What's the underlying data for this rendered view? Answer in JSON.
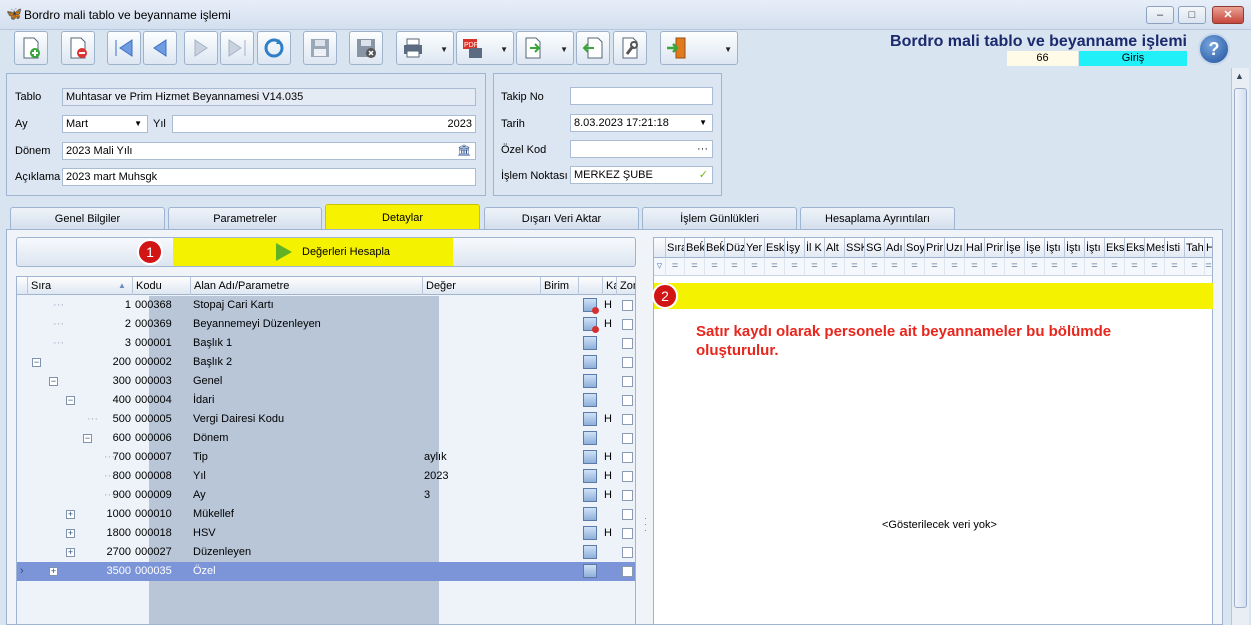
{
  "window": {
    "title": "Bordro mali tablo ve beyanname işlemi",
    "minimize": "–",
    "maximize": "□",
    "close": "✕"
  },
  "header": {
    "title": "Bordro mali tablo ve beyanname işlemi",
    "count": "66",
    "mode": "Giriş",
    "help": "?"
  },
  "toolbar": {
    "icons": [
      "new-doc-icon",
      "delete-doc-icon",
      "first-icon",
      "prev-icon",
      "next-icon",
      "last-icon",
      "refresh-icon",
      "save-icon",
      "cancel-save-icon",
      "print-icon",
      "pdf-icon",
      "export-icon",
      "import-icon",
      "tools-icon",
      "exit-icon"
    ]
  },
  "form_left": {
    "tablo_label": "Tablo",
    "tablo_value": "Muhtasar ve Prim Hizmet Beyannamesi V14.035",
    "ay_label": "Ay",
    "ay_value": "Mart",
    "yil_label": "Yıl",
    "yil_value": "2023",
    "donem_label": "Dönem",
    "donem_value": "2023 Mali Yılı",
    "aciklama_label": "Açıklama",
    "aciklama_value": "2023 mart Muhsgk"
  },
  "form_right": {
    "takip_label": "Takip No",
    "takip_value": "",
    "tarih_label": "Tarih",
    "tarih_value": "8.03.2023 17:21:18",
    "ozelkod_label": "Özel Kod",
    "ozelkod_value": "",
    "islem_label": "İşlem Noktası",
    "islem_value": "MERKEZ ŞUBE"
  },
  "tabs": [
    "Genel Bilgiler",
    "Parametreler",
    "Detaylar",
    "Dışarı Veri Aktar",
    "İşlem Günlükleri",
    "Hesaplama Ayrıntıları"
  ],
  "active_tab": "Detaylar",
  "calc_button": "Değerleri Hesapla",
  "badge1": "1",
  "badge2": "2",
  "left_grid": {
    "columns": [
      "Sıra",
      "Kodu",
      "Alan Adı/Parametre",
      "Değer",
      "Birim",
      "Ka",
      "Zor"
    ],
    "rows": [
      {
        "sira": "1",
        "kodu": "000368",
        "alan": "Stopaj Cari Kartı",
        "deger": "",
        "h": "H"
      },
      {
        "sira": "2",
        "kodu": "000369",
        "alan": "Beyannemeyi Düzenleyen",
        "deger": "",
        "h": "H"
      },
      {
        "sira": "3",
        "kodu": "000001",
        "alan": "Başlık 1",
        "deger": "",
        "h": ""
      },
      {
        "sira": "200",
        "kodu": "000002",
        "alan": "Başlık 2",
        "deger": "",
        "h": ""
      },
      {
        "sira": "300",
        "kodu": "000003",
        "alan": "Genel",
        "deger": "",
        "h": ""
      },
      {
        "sira": "400",
        "kodu": "000004",
        "alan": "İdari",
        "deger": "",
        "h": ""
      },
      {
        "sira": "500",
        "kodu": "000005",
        "alan": "Vergi Dairesi Kodu",
        "deger": "",
        "h": "H"
      },
      {
        "sira": "600",
        "kodu": "000006",
        "alan": "Dönem",
        "deger": "",
        "h": ""
      },
      {
        "sira": "700",
        "kodu": "000007",
        "alan": "Tip",
        "deger": "aylık",
        "h": "H"
      },
      {
        "sira": "800",
        "kodu": "000008",
        "alan": "Yıl",
        "deger": "2023",
        "h": "H"
      },
      {
        "sira": "900",
        "kodu": "000009",
        "alan": "Ay",
        "deger": "3",
        "h": "H"
      },
      {
        "sira": "1000",
        "kodu": "000010",
        "alan": "Mükellef",
        "deger": "",
        "h": ""
      },
      {
        "sira": "1800",
        "kodu": "000018",
        "alan": "HSV",
        "deger": "",
        "h": "H"
      },
      {
        "sira": "2700",
        "kodu": "000027",
        "alan": "Düzenleyen",
        "deger": "",
        "h": ""
      },
      {
        "sira": "3500",
        "kodu": "000035",
        "alan": "Özel",
        "deger": "",
        "h": ""
      }
    ]
  },
  "right_grid": {
    "columns": [
      "Sıra",
      "Beḱ",
      "Beḱ",
      "Düz",
      "Yer",
      "Esk",
      "İşy",
      "İl K",
      "Alt",
      "SSK",
      "SG",
      "Adı",
      "Soy",
      "Prir",
      "Uzı",
      "Hal",
      "Prir",
      "İşe",
      "İşe",
      "İştı",
      "İştı",
      "İştı",
      "Eks",
      "Eks",
      "Mes",
      "İsti",
      "Tah",
      "H"
    ],
    "filter_symbol": "=",
    "info_text": "Satır kaydı olarak personele ait beyannameler bu bölümde oluşturulur.",
    "empty_text": "<Gösterilecek veri yok>"
  }
}
